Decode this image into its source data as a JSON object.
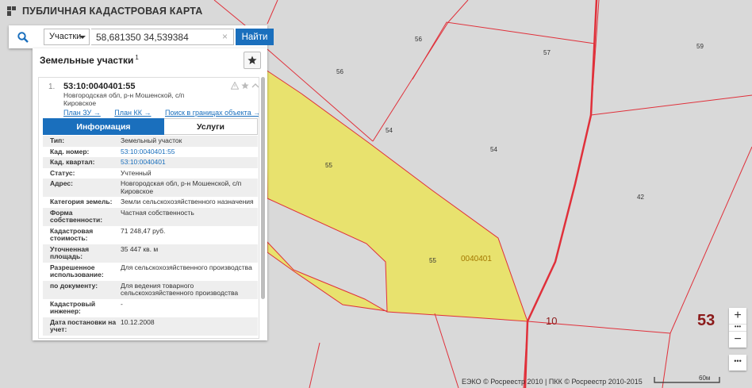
{
  "header": {
    "app_title": "ПУБЛИЧНАЯ КАДАСТРОВАЯ КАРТА",
    "logo_icon": "pkk-logo-icon"
  },
  "search": {
    "icon": "search-icon",
    "scope_value": "Участки",
    "query_value": "58,681350 34,539384",
    "clear_label": "×",
    "button_label": "Найти"
  },
  "panel": {
    "title": "Земельные участки",
    "title_count": "1",
    "item": {
      "number": "1.",
      "cadastral_id": "53:10:0040401:55",
      "address": "Новгородская обл, р-н Мошенской, с/п Кировское",
      "links": [
        "План ЗУ →",
        "План КК →",
        "Поиск в границах объекта →"
      ],
      "tabs": {
        "info": "Информация",
        "services": "Услуги"
      },
      "rows": [
        {
          "key": "Тип:",
          "value": "Земельный участок"
        },
        {
          "key": "Кад. номер:",
          "value": "53:10:0040401:55"
        },
        {
          "key": "Кад. квартал:",
          "value": "53:10:0040401"
        },
        {
          "key": "Статус:",
          "value": "Учтенный"
        },
        {
          "key": "Адрес:",
          "value": "Новгородская обл, р-н Мошенской, с/п Кировское"
        },
        {
          "key": "Категория земель:",
          "value": "Земли сельскохозяйственного назначения"
        },
        {
          "key": "Форма собственности:",
          "value": "Частная собственность"
        },
        {
          "key": "Кадастровая стоимость:",
          "value": "71 248,47 руб."
        },
        {
          "key": "Уточненная площадь:",
          "value": "35 447 кв. м"
        },
        {
          "key": "Разрешенное использование:",
          "value": "Для сельскохозяйственного производства"
        },
        {
          "key": "по документу:",
          "value": "Для ведения товарного сельскохозяйственного производства"
        },
        {
          "key": "Кадастровый инженер:",
          "value": "-"
        },
        {
          "key": "Дата постановки на учет:",
          "value": "10.12.2008"
        }
      ]
    }
  },
  "map": {
    "parcel_labels": [
      "56",
      "57",
      "59",
      "56",
      "54",
      "54",
      "55",
      "42",
      "55"
    ],
    "quarter_label": "0040401",
    "district_label": "10",
    "region_label": "53",
    "colors": {
      "background": "#d9d9d9",
      "parcel_fill": "#e8e26e",
      "boundary": "#e0303a",
      "region_label": "#8b1a1a",
      "accent": "#1a6fbd"
    }
  },
  "controls": {
    "zoom_in": "+",
    "zoom_dots": "•••",
    "zoom_out": "−",
    "more": "•••"
  },
  "footer": {
    "copyright": "ЕЭКО © Росреестр 2010 | ПКК © Росреестр 2010-2015",
    "scale_label": "60м"
  }
}
